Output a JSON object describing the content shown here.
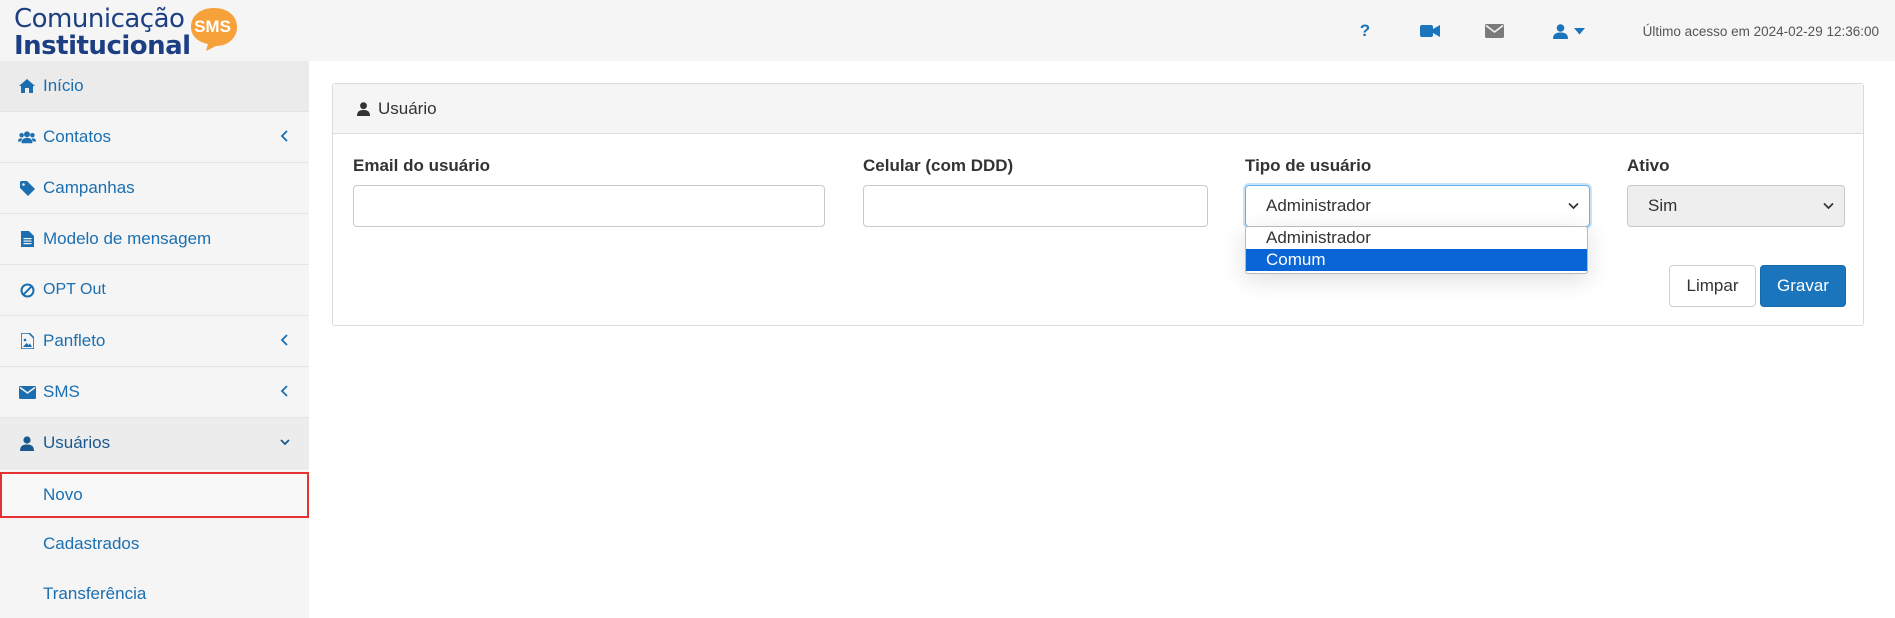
{
  "app": {
    "logo_line1": "Comunicação",
    "logo_line2": "Institucional",
    "logo_badge": "SMS"
  },
  "topbar": {
    "help_label": "?",
    "icons": [
      "question-icon",
      "video-camera-icon",
      "envelope-icon",
      "user-icon",
      "caret-down-icon"
    ],
    "last_access": "Último acesso em 2024-02-29 12:36:00"
  },
  "sidebar": {
    "items": [
      {
        "label": "Início",
        "icon": "home-icon"
      },
      {
        "label": "Contatos",
        "icon": "users-icon",
        "expandable": true
      },
      {
        "label": "Campanhas",
        "icon": "tag-icon"
      },
      {
        "label": "Modelo de mensagem",
        "icon": "file-text-icon"
      },
      {
        "label": "OPT Out",
        "icon": "ban-icon"
      },
      {
        "label": "Panfleto",
        "icon": "image-file-icon",
        "expandable": true
      },
      {
        "label": "SMS",
        "icon": "envelope-icon",
        "expandable": true
      },
      {
        "label": "Usuários",
        "icon": "user-icon",
        "expandable": true,
        "expanded": true
      }
    ],
    "sub_items": [
      {
        "label": "Novo",
        "selected": true
      },
      {
        "label": "Cadastrados"
      },
      {
        "label": "Transferência"
      }
    ]
  },
  "panel": {
    "title": "Usuário",
    "fields": {
      "email": {
        "label": "Email do usuário",
        "value": ""
      },
      "phone": {
        "label": "Celular (com DDD)",
        "value": ""
      },
      "user_type": {
        "label": "Tipo de usuário",
        "value": "Administrador",
        "options": [
          "Administrador",
          "Comum"
        ],
        "highlighted": "Comum"
      },
      "active": {
        "label": "Ativo",
        "value": "Sim"
      }
    },
    "buttons": {
      "clear": "Limpar",
      "save": "Gravar"
    }
  },
  "colors": {
    "brand_blue": "#1b75bc",
    "logo_navy": "#1c3f84",
    "logo_orange": "#f6a13a",
    "highlight": "#0a66d6",
    "selected_outline": "#e53333"
  }
}
